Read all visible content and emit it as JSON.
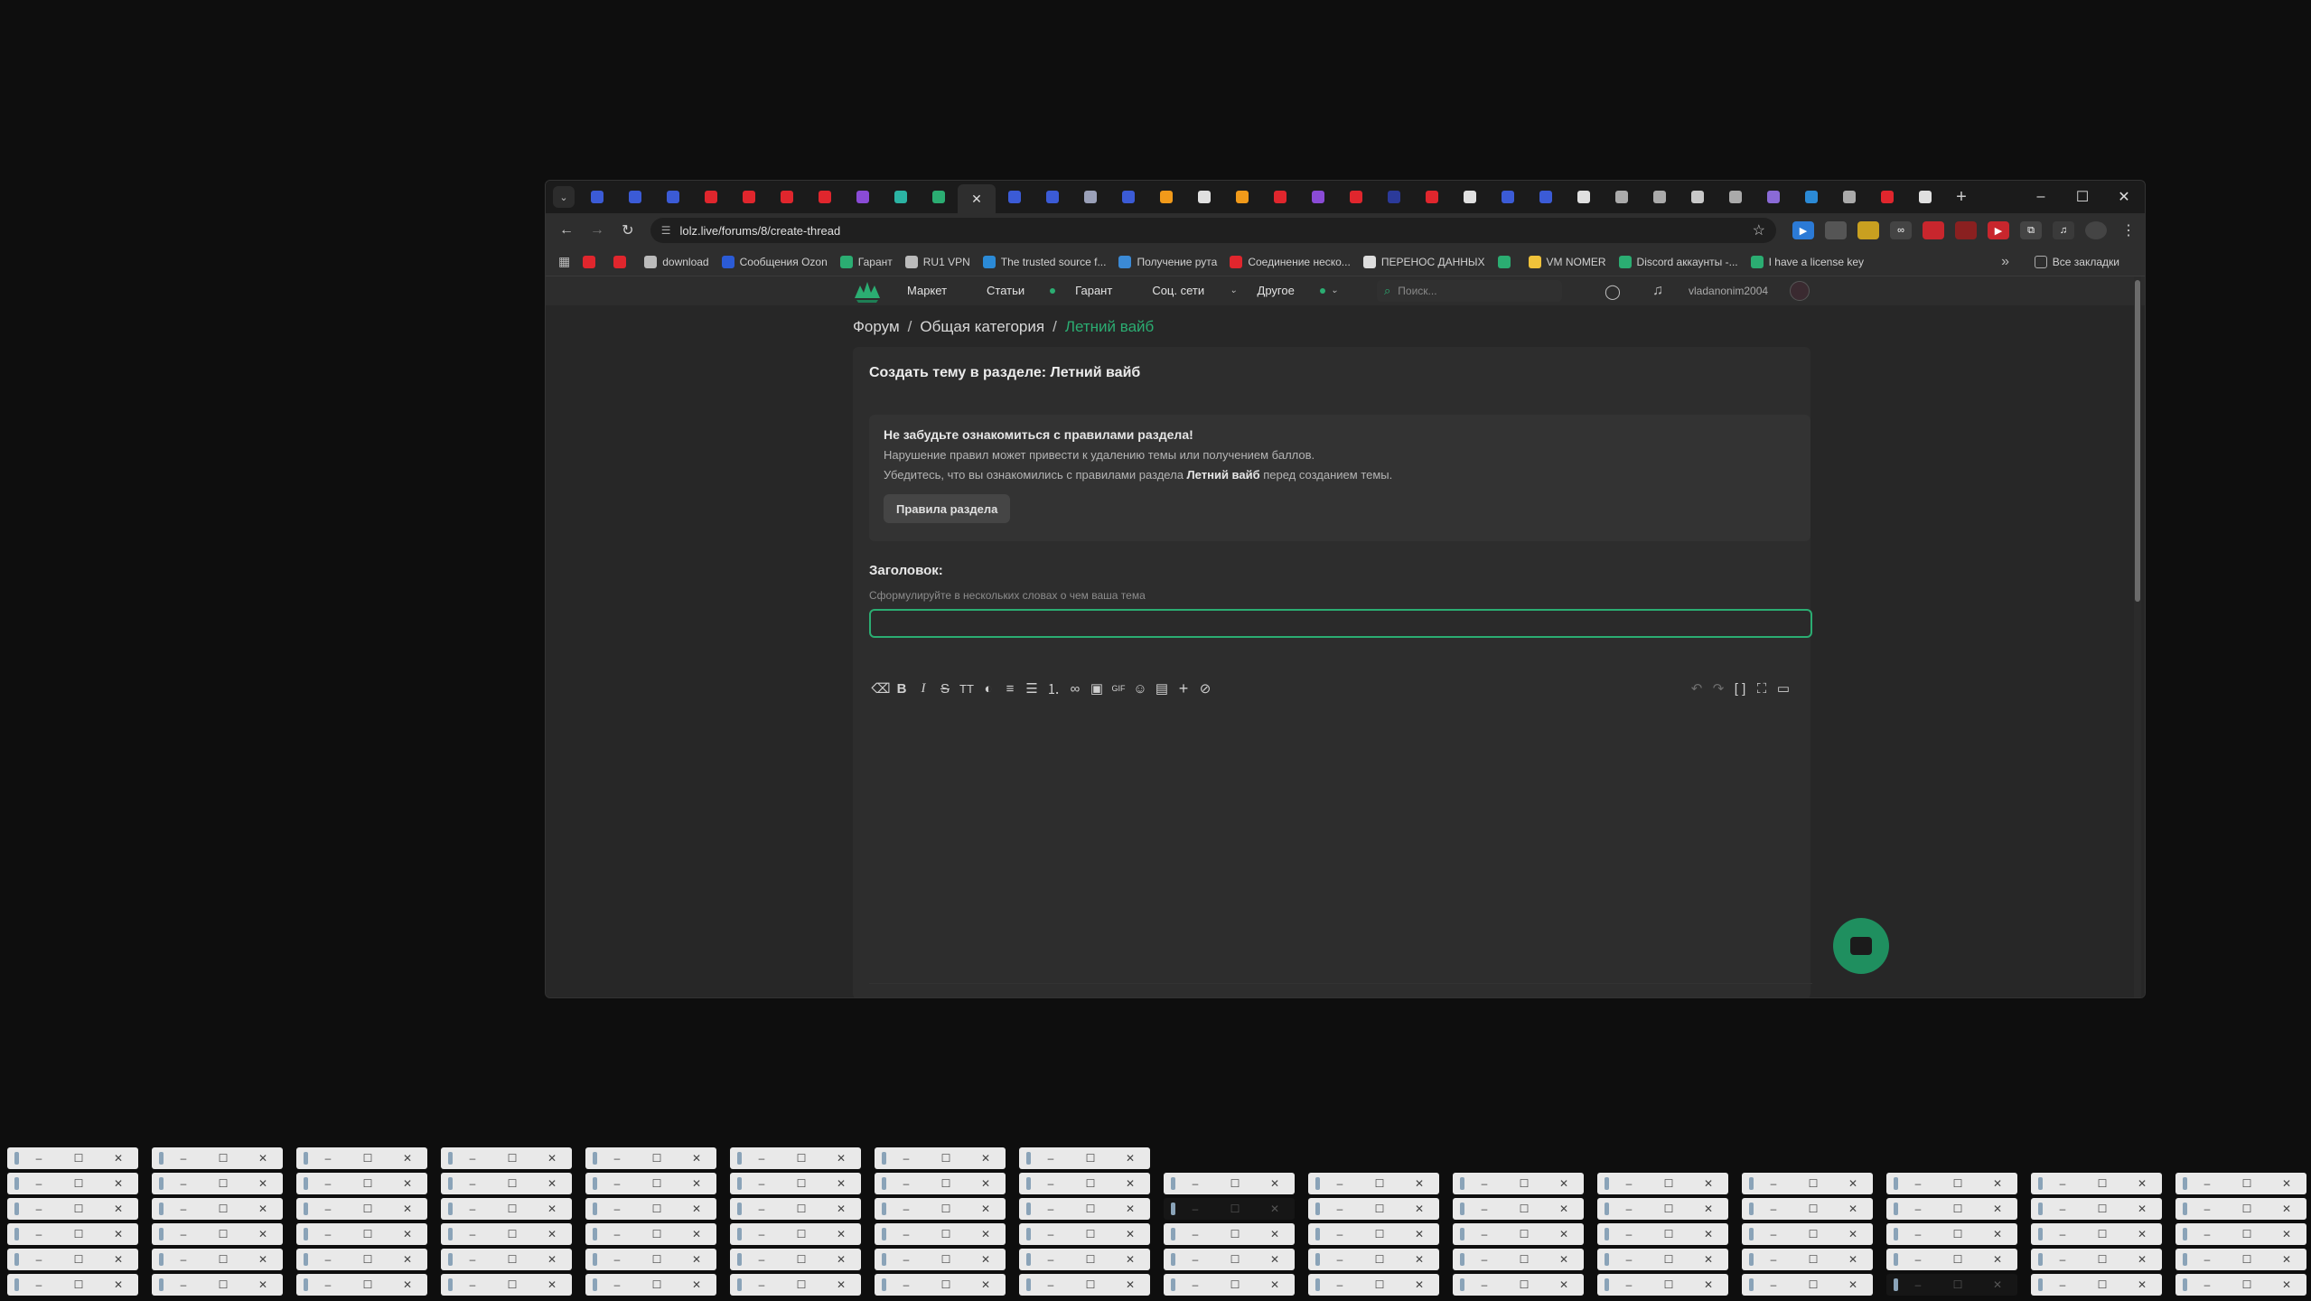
{
  "browser": {
    "tabs": [
      {
        "color": "#3b5bd6"
      },
      {
        "color": "#3b5bd6"
      },
      {
        "color": "#3b5bd6"
      },
      {
        "color": "#e0262d"
      },
      {
        "color": "#e0262d"
      },
      {
        "color": "#e0262d"
      },
      {
        "color": "#e0262d"
      },
      {
        "color": "#8a4bd6"
      },
      {
        "color": "#2bb3a3"
      },
      {
        "color": "#2bad72"
      },
      {
        "color": "#e0e0e0",
        "active": true
      },
      {
        "color": "#3b5bd6"
      },
      {
        "color": "#3b5bd6"
      },
      {
        "color": "#9aa0b8"
      },
      {
        "color": "#3b5bd6"
      },
      {
        "color": "#f19a1a"
      },
      {
        "color": "#e0e0e0"
      },
      {
        "color": "#f19a1a"
      },
      {
        "color": "#e0262d"
      },
      {
        "color": "#8a4bd6"
      },
      {
        "color": "#e0262d"
      },
      {
        "color": "#2b3a9a"
      },
      {
        "color": "#e0262d"
      },
      {
        "color": "#e0e0e0"
      },
      {
        "color": "#3b5bd6"
      },
      {
        "color": "#3b5bd6"
      },
      {
        "color": "#e0e0e0"
      },
      {
        "color": "#aaaaaa"
      },
      {
        "color": "#aaaaaa"
      },
      {
        "color": "#c8c8c8"
      },
      {
        "color": "#aaaaaa"
      },
      {
        "color": "#8a6ad6"
      },
      {
        "color": "#2b8ad6"
      },
      {
        "color": "#aaaaaa"
      },
      {
        "color": "#e0262d"
      },
      {
        "color": "#e0e0e0"
      }
    ],
    "url": "lolz.live/forums/8/create-thread",
    "bookmarks": [
      {
        "label": "",
        "color": "#e0262d"
      },
      {
        "label": "",
        "color": "#e0262d"
      },
      {
        "label": "download",
        "color": "#bbbbbb"
      },
      {
        "label": "Сообщения Ozon",
        "color": "#2b5bd6"
      },
      {
        "label": "Гарант",
        "color": "#2bad72"
      },
      {
        "label": "RU1 VPN",
        "color": "#bbbbbb"
      },
      {
        "label": "The trusted source f...",
        "color": "#2b8ad6"
      },
      {
        "label": "Получение рута",
        "color": "#3b8ad6"
      },
      {
        "label": "Соединение неско...",
        "color": "#e0262d"
      },
      {
        "label": "ПЕРЕНОС ДАННЫХ",
        "color": "#dddddd"
      },
      {
        "label": "",
        "color": "#2bad72"
      },
      {
        "label": "VM NOMER",
        "color": "#f0c23a"
      },
      {
        "label": "Discord аккаунты -...",
        "color": "#2bad72"
      },
      {
        "label": "I have a license key",
        "color": "#2bad72"
      }
    ],
    "all_bookmarks": "Все закладки"
  },
  "site": {
    "nav": {
      "market": "Маркет",
      "articles": "Статьи",
      "guarantor": "Гарант",
      "social": "Соц. сети",
      "other": "Другое"
    },
    "search_placeholder": "Поиск...",
    "username": "vladanonim2004",
    "accent": "#2bad72"
  },
  "breadcrumb": {
    "forum": "Форум",
    "category": "Общая категория",
    "section": "Летний вайб"
  },
  "form": {
    "heading": "Создать тему в разделе: Летний вайб",
    "notice_title": "Не забудьте ознакомиться с правилами раздела!",
    "notice_line1": "Нарушение правил может привести к удалению темы или получением баллов.",
    "notice_line2_pre": "Убедитесь, что вы ознакомились с правилами раздела ",
    "notice_line2_bold": "Летний вайб",
    "notice_line2_post": " перед созданием темы.",
    "rules_button": "Правила раздела",
    "title_label": "Заголовок:",
    "title_hint": "Сформулируйте в нескольких словах о чем ваша тема",
    "title_value": ""
  },
  "editor_tools": [
    "eraser-icon",
    "bold-icon",
    "italic-icon",
    "strike-icon",
    "text-size-icon",
    "color-icon",
    "align-icon",
    "bullet-list-icon",
    "numbered-list-icon",
    "link-icon",
    "image-icon",
    "gif-icon",
    "emoji-icon",
    "media-icon",
    "plus-icon",
    "hide-icon"
  ],
  "editor_tools_right": [
    "undo-icon",
    "redo-icon",
    "brackets-icon",
    "fullscreen-icon",
    "save-draft-icon"
  ],
  "editor_labels": {
    "bold": "B",
    "italic": "I",
    "strike": "S",
    "text_size": "TT",
    "gif": "GIF"
  }
}
